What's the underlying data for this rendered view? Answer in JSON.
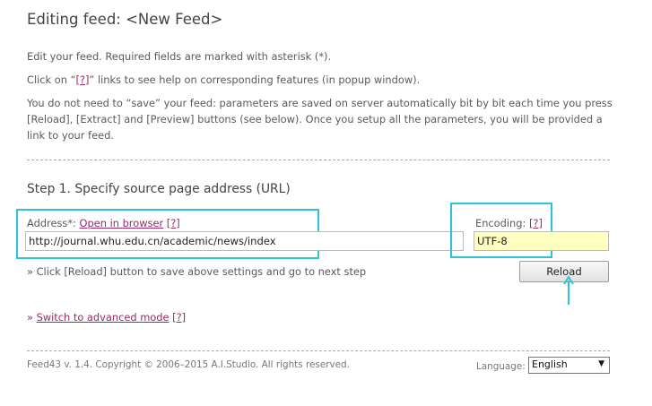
{
  "header": {
    "title": "Editing feed: <New Feed>"
  },
  "intro": {
    "line1": "Edit your feed. Required fields are marked with asterisk (*).",
    "help_prefix": "Click on “",
    "help_link": "[?]",
    "help_suffix": "” links to see help on corresponding features (in popup window).",
    "save_note": "You do not need to “save” your feed: parameters are saved on server automatically bit by bit each time you press [Reload], [Extract] and [Preview] buttons (see below). Once you setup all the parameters, you will be provided a link to your feed."
  },
  "step1": {
    "heading": "Step 1. Specify source page address (URL)",
    "address_label": "Address*: ",
    "open_in_browser": "Open in browser",
    "address_help": "[?]",
    "address_value": "http://journal.whu.edu.cn/academic/news/index",
    "encoding_label": "Encoding: ",
    "encoding_help": "[?]",
    "encoding_value": "UTF-8",
    "hint": "» Click [Reload] button to save above settings and go to next step",
    "reload_label": "Reload"
  },
  "advanced": {
    "prefix": "» ",
    "link": "Switch to advanced mode",
    "help": "[?]"
  },
  "footer": {
    "copyright": "Feed43 v. 1.4. Copyright © 2006–2015 A.I.Studio. All rights reserved.",
    "language_label": "Language: ",
    "language_value": "English"
  },
  "icons": {
    "dropdown": "chevron-down-icon",
    "annotation": "arrow-up-icon"
  },
  "colors": {
    "highlight": "#2bc4d8",
    "encoding_bg": "#ffffc0",
    "link": "#9b2a6a"
  }
}
